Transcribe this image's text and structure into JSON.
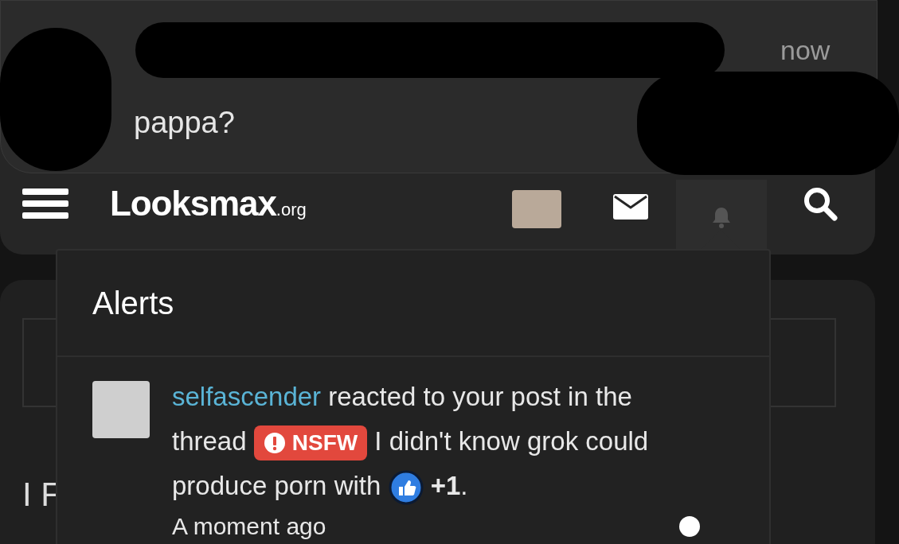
{
  "notification": {
    "time": "now",
    "message": "pappa?"
  },
  "header": {
    "logo": "Looksmax",
    "logo_suffix": ".org"
  },
  "page": {
    "heading_fragment": "I F"
  },
  "alerts": {
    "title": "Alerts",
    "items": [
      {
        "user": "selfascender",
        "text_before": "reacted to your post in the thread",
        "tag": "NSFW",
        "text_after": "I didn't know grok could produce porn with",
        "reaction": "+1",
        "end": ".",
        "time": "A moment ago",
        "unread": true
      }
    ]
  }
}
